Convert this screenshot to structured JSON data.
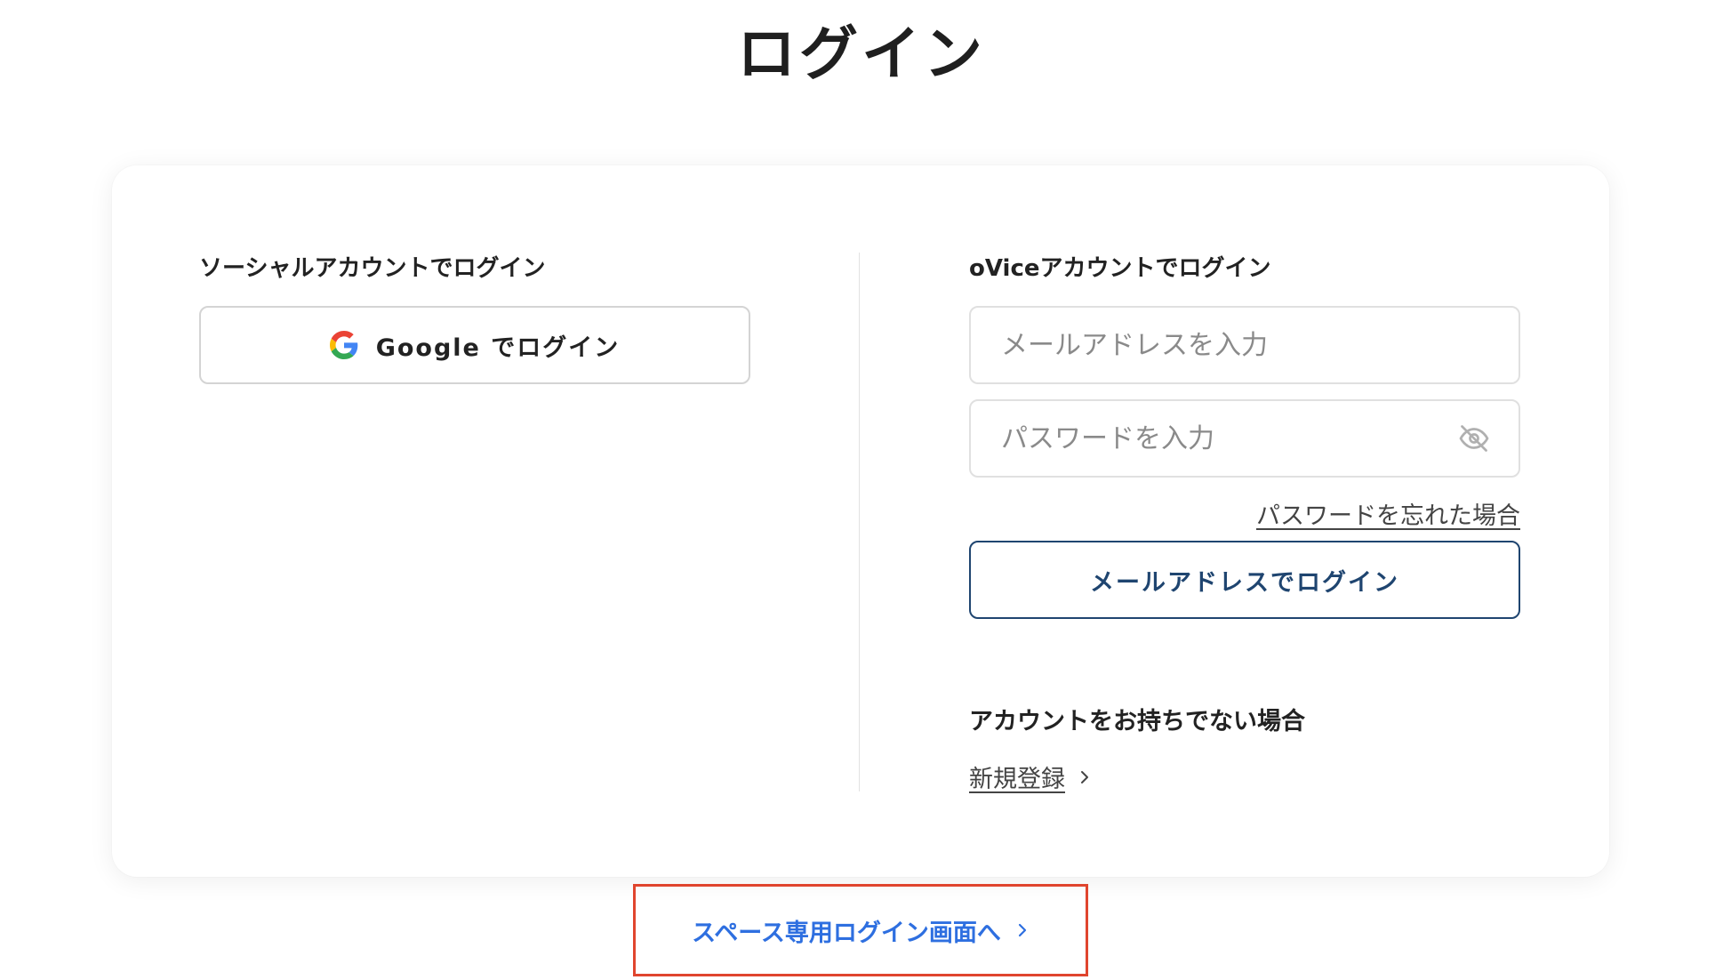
{
  "page": {
    "title": "ログイン"
  },
  "social": {
    "heading": "ソーシャルアカウントでログイン",
    "google_button_label": "Google でログイン",
    "google_icon": "google-g-icon"
  },
  "ovice": {
    "heading": "oViceアカウントでログイン",
    "email_placeholder": "メールアドレスを入力",
    "email_value": "",
    "password_placeholder": "パスワードを入力",
    "password_value": "",
    "password_toggle_icon": "eye-off-icon",
    "forgot_password_label": "パスワードを忘れた場合",
    "email_login_button_label": "メールアドレスでログイン"
  },
  "signup": {
    "heading": "アカウントをお持ちでない場合",
    "link_label": "新規登録",
    "link_icon": "chevron-right-icon"
  },
  "space_login": {
    "link_label": "スペース専用ログイン画面へ",
    "link_icon": "chevron-right-icon",
    "highlight_color": "#e0452e"
  },
  "colors": {
    "primary_navy": "#1f4570",
    "link_blue": "#2e6fe0",
    "highlight_red": "#e0452e"
  }
}
